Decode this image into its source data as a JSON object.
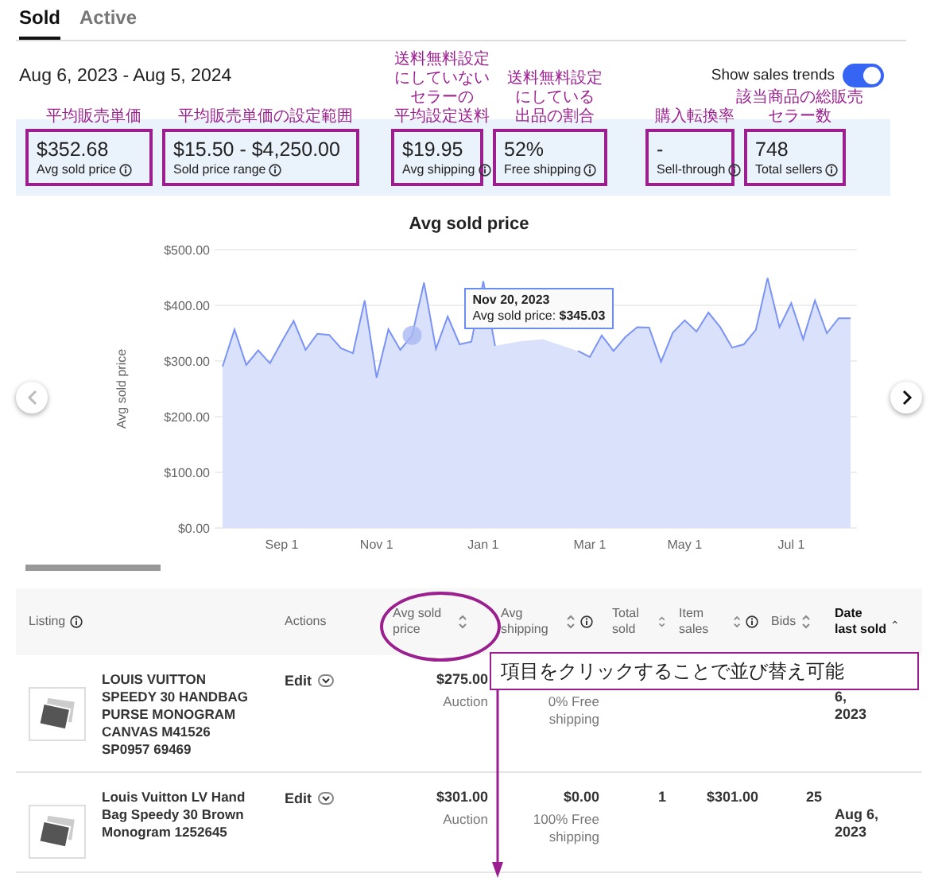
{
  "tabs": [
    {
      "label": "Sold",
      "selected": true
    },
    {
      "label": "Active",
      "selected": false
    }
  ],
  "date_range": "Aug 6, 2023 - Aug 5, 2024",
  "sales_trends_toggle": {
    "label": "Show sales trends",
    "on": true
  },
  "stats": [
    {
      "value": "$352.68",
      "label": "Avg sold price",
      "note": [
        "平均販売単価"
      ]
    },
    {
      "value": "$15.50 - $4,250.00",
      "label": "Sold price range",
      "note": [
        "平均販売単価の設定範囲"
      ]
    },
    {
      "value": "$19.95",
      "label": "Avg shipping",
      "note": [
        "送料無料設定",
        "にしていない",
        "セラーの",
        "平均設定送料"
      ]
    },
    {
      "value": "52%",
      "label": "Free shipping",
      "note": [
        "送料無料設定",
        "にしている",
        "出品の割合"
      ]
    },
    {
      "value": "-",
      "label": "Sell-through",
      "note": [
        "購入転換率"
      ]
    },
    {
      "value": "748",
      "label": "Total sellers",
      "note": [
        "該当商品の総販売",
        "セラー数"
      ]
    }
  ],
  "chart": {
    "prev_disabled": true,
    "next_disabled": false,
    "tooltip": {
      "date": "Nov 20, 2023",
      "text": "Avg sold price: **$345.03**"
    },
    "chart_data": {
      "type": "area",
      "title": "Avg sold price",
      "ylabel": "Avg sold price",
      "categories": [
        null,
        null,
        null,
        null,
        null,
        "Sep 1",
        null,
        null,
        null,
        null,
        null,
        null,
        null,
        "Nov 1",
        null,
        null,
        null,
        null,
        null,
        null,
        null,
        null,
        "Jan 1",
        null,
        null,
        null,
        null,
        null,
        null,
        null,
        null,
        "Mar 1",
        null,
        null,
        null,
        null,
        null,
        null,
        null,
        "May 1",
        null,
        null,
        null,
        null,
        null,
        null,
        null,
        null,
        "Jul 1",
        null,
        null,
        null,
        null,
        null
      ],
      "grid": true,
      "values": [
        290,
        357,
        293,
        319,
        296,
        335,
        372,
        320,
        349,
        347,
        323,
        314,
        409,
        270,
        357,
        320,
        346,
        441,
        322,
        380,
        330,
        335,
        443,
        327,
        null,
        335,
        null,
        339,
        null,
        null,
        318,
        307,
        346,
        318,
        343,
        361,
        360,
        299,
        351,
        373,
        353,
        387,
        361,
        324,
        330,
        356,
        449,
        361,
        404,
        339,
        409,
        350,
        377,
        377
      ],
      "ylim": [
        0,
        500
      ],
      "yticks": [
        {
          "value": 0,
          "label": "$0.00"
        },
        {
          "value": 100,
          "label": "$100.00"
        },
        {
          "value": 200,
          "label": "$200.00"
        },
        {
          "value": 300,
          "label": "$300.00"
        },
        {
          "value": 400,
          "label": "$400.00"
        },
        {
          "value": 500,
          "label": "$500.00"
        }
      ]
    }
  },
  "table": {
    "columns": [
      {
        "label": "Listing",
        "info": true,
        "sortable": false,
        "sorted": false,
        "bold": false
      },
      {
        "label": "Actions",
        "info": false,
        "sortable": false,
        "sorted": false,
        "bold": false
      },
      {
        "label": "Avg sold price",
        "info": false,
        "sortable": true,
        "sorted": false,
        "bold": false
      },
      {
        "label": "Avg shipping",
        "info": true,
        "sortable": true,
        "sorted": false,
        "bold": false
      },
      {
        "label": "Total sold",
        "info": false,
        "sortable": true,
        "sorted": false,
        "bold": false
      },
      {
        "label": "Item sales",
        "info": true,
        "sortable": true,
        "sorted": false,
        "bold": false
      },
      {
        "label": "Bids",
        "info": false,
        "sortable": true,
        "sorted": false,
        "bold": false
      },
      {
        "label": "Date last sold",
        "info": false,
        "sortable": true,
        "sorted": true,
        "bold": true
      }
    ],
    "rows": [
      {
        "title": "LOUIS VUITTON SPEEDY 30 HANDBAG PURSE MONOGRAM CANVAS M41526 SP0957 69469",
        "action": "Edit",
        "price": "$275.00",
        "format": "Auction",
        "shipping_note": "0% Free shipping",
        "date": "6, 2023"
      },
      {
        "title": "Louis Vuitton LV Hand Bag Speedy 30 Brown Monogram 1252645",
        "action": "Edit",
        "price": "$301.00",
        "format": "Auction",
        "shipping": "$0.00",
        "shipping_note": "100% Free shipping",
        "total_sold": "1",
        "item_sales": "$301.00",
        "bids": "25",
        "date": "Aug 6, 2023"
      }
    ]
  },
  "callout": "項目をクリックすることで並び替え可能"
}
